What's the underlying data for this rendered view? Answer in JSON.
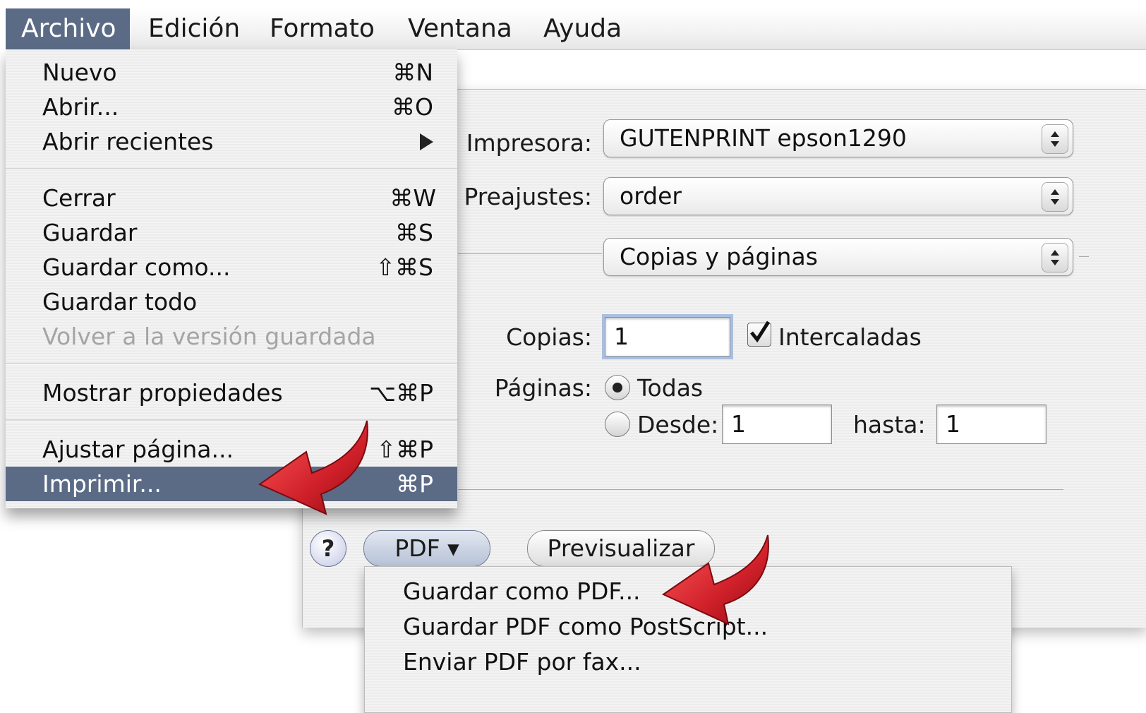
{
  "menubar": {
    "items": [
      "Archivo",
      "Edición",
      "Formato",
      "Ventana",
      "Ayuda"
    ],
    "active": "Archivo"
  },
  "file_menu": {
    "items": [
      {
        "label": "Nuevo",
        "shortcut": "⌘N"
      },
      {
        "label": "Abrir...",
        "shortcut": "⌘O"
      },
      {
        "label": "Abrir recientes",
        "submenu_icon": "triangle-right-icon"
      },
      {
        "label": "Cerrar",
        "shortcut": "⌘W"
      },
      {
        "label": "Guardar",
        "shortcut": "⌘S"
      },
      {
        "label": "Guardar como...",
        "shortcut": "⇧⌘S"
      },
      {
        "label": "Guardar todo"
      },
      {
        "label": "Volver a la versión guardada",
        "disabled": true
      },
      {
        "label": "Mostrar propiedades",
        "shortcut": "⌥⌘P"
      },
      {
        "label": "Ajustar página...",
        "shortcut": "⇧⌘P"
      },
      {
        "label": "Imprimir...",
        "shortcut": "⌘P",
        "selected": true
      }
    ]
  },
  "print_dialog": {
    "printer_label": "Impresora:",
    "printer_value": "GUTENPRINT epson1290",
    "presets_label": "Preajustes:",
    "presets_value": "order",
    "panel_value": "Copias y páginas",
    "copies_label": "Copias:",
    "copies_value": "1",
    "collate_label": "Intercaladas",
    "collate_checked": true,
    "pages_label": "Páginas:",
    "pages_all_label": "Todas",
    "pages_all_selected": true,
    "pages_from_label": "Desde:",
    "pages_from_value": "1",
    "pages_to_label": "hasta:",
    "pages_to_value": "1",
    "help_label": "?",
    "pdf_button_label": "PDF ▾",
    "preview_button_label": "Previsualizar"
  },
  "pdf_menu": {
    "items": [
      "Guardar como PDF...",
      "Guardar PDF como PostScript...",
      "Enviar PDF por fax..."
    ]
  },
  "colors": {
    "menu_selection": "#5b6b86",
    "annotation_arrow": "#d0202a"
  }
}
